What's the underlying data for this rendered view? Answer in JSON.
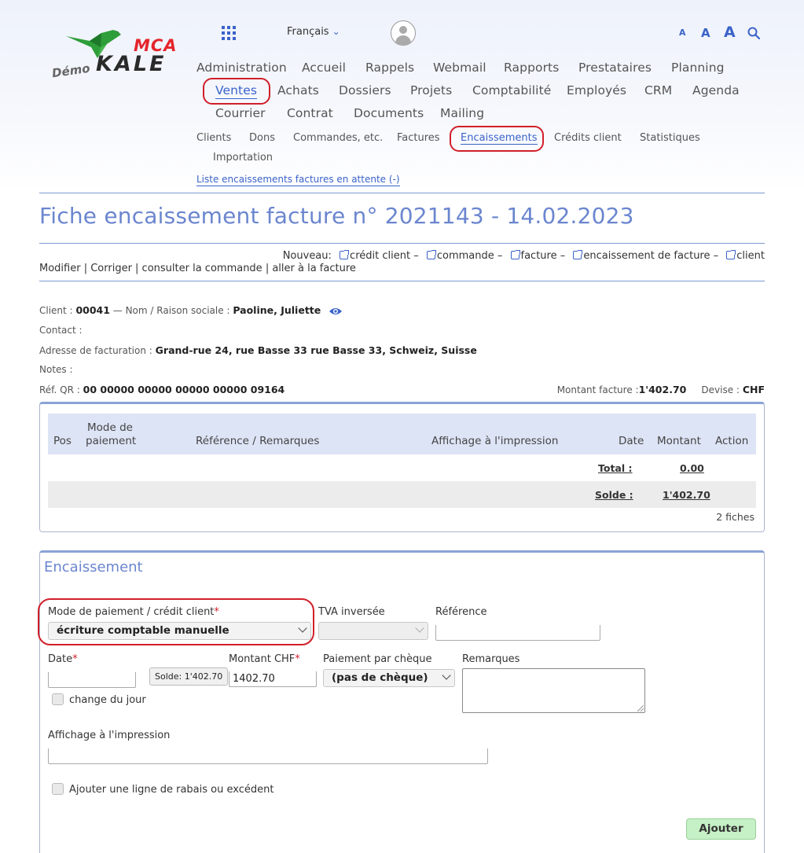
{
  "logo": {
    "brand_top": "MCA",
    "brand_main": "KALE",
    "demo": "Démo"
  },
  "header": {
    "language": "Français",
    "font_sizes": [
      "A",
      "A",
      "A"
    ]
  },
  "main_nav": [
    "Administration",
    "Accueil",
    "Rappels",
    "Webmail",
    "Rapports",
    "Prestataires",
    "Planning",
    "Ventes",
    "Achats",
    "Dossiers",
    "Projets",
    "Comptabilité",
    "Employés",
    "CRM",
    "Agenda",
    "Courrier",
    "Contrat",
    "Documents",
    "Mailing"
  ],
  "sub_nav": [
    "Clients",
    "Dons",
    "Commandes, etc.",
    "Factures",
    "Encaissements",
    "Crédits client",
    "Statistiques",
    "Importation"
  ],
  "pending_link": "Liste encaissements factures en attente (-)",
  "page_title": "Fiche encaissement facture n° 2021143 - 14.02.2023",
  "nouveau": {
    "label": "Nouveau:",
    "items": [
      "crédit client",
      "commande",
      "facture",
      "encaissement de facture",
      "client"
    ],
    "sep": "–"
  },
  "actions": "Modifier | Corriger | consulter la commande | aller à la facture",
  "info": {
    "client_label": "Client :",
    "client_value": "00041",
    "name_label": "— Nom / Raison sociale :",
    "name_value": "Paoline, Juliette",
    "contact_label": "Contact :",
    "address_label": "Adresse de facturation :",
    "address_value": "Grand-rue 24, rue Basse 33 rue Basse 33, Schweiz, Suisse",
    "notes_label": "Notes :",
    "qr_label": "Réf. QR :",
    "qr_value": "00 00000 00000 00000 00000 09164",
    "amount_label": "Montant facture :",
    "amount_value": "1'402.70",
    "currency_label": "Devise :",
    "currency_value": "CHF"
  },
  "table": {
    "headers": {
      "pos": "Pos",
      "mode1": "Mode de",
      "mode2": "paiement",
      "ref": "Référence / Remarques",
      "print": "Affichage à l'impression",
      "date": "Date",
      "amount": "Montant",
      "action": "Action"
    },
    "total_label": "Total :",
    "total_value": "0.00",
    "solde_label": "Solde :",
    "solde_value": "1'402.70",
    "count": "2 fiches"
  },
  "form": {
    "title": "Encaissement",
    "mode_label": "Mode de paiement / crédit client",
    "mode_value": "écriture comptable manuelle",
    "tva_label": "TVA inversée",
    "tva_value": "",
    "ref_label": "Référence",
    "ref_value": "",
    "date_label": "Date",
    "date_value": "",
    "solde_btn": "Solde: 1'402.70",
    "amount_label": "Montant CHF",
    "amount_value": "1402.70",
    "cheque_label": "Paiement par chèque",
    "cheque_value": "(pas de chèque)",
    "remarks_label": "Remarques",
    "change_label": "change du jour",
    "print_label": "Affichage à l'impression",
    "discount_label": "Ajouter une ligne de rabais ou excédent",
    "add_button": "Ajouter",
    "required_mark": "*"
  },
  "colors": {
    "accent": "#3a63c9",
    "title": "#6b86cf",
    "highlight_circle": "#d11f2a",
    "add_button": "#c6f0c6"
  }
}
